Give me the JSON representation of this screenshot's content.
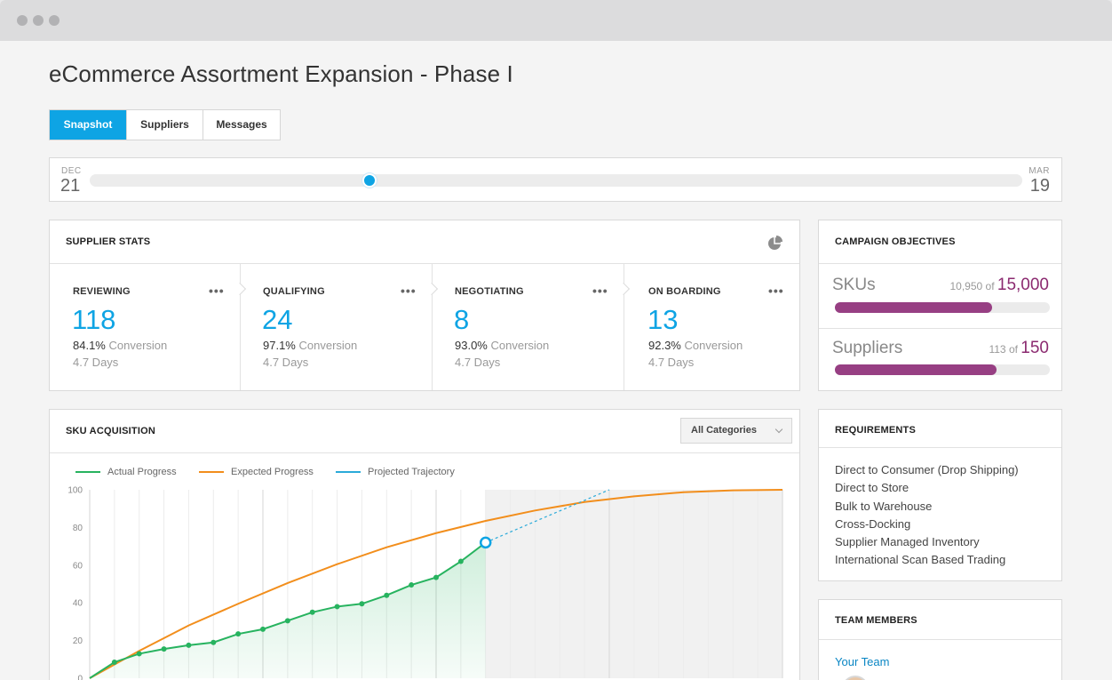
{
  "window": {
    "title_dots": [
      "close",
      "minimize",
      "maximize"
    ]
  },
  "page": {
    "title": "eCommerce Assortment Expansion - Phase I"
  },
  "tabs": [
    {
      "label": "Snapshot",
      "active": true
    },
    {
      "label": "Suppliers",
      "active": false
    },
    {
      "label": "Messages",
      "active": false
    }
  ],
  "timeline": {
    "start_month": "DEC",
    "start_day": "21",
    "end_month": "MAR",
    "end_day": "19",
    "position": 0.3
  },
  "supplier_stats": {
    "title": "SUPPLIER STATS",
    "icon": "pie-chart-icon",
    "stages": [
      {
        "label": "REVIEWING",
        "value": "118",
        "conversion": "84.1%",
        "conversion_label": "Conversion",
        "days": "4.7 Days"
      },
      {
        "label": "QUALIFYING",
        "value": "24",
        "conversion": "97.1%",
        "conversion_label": "Conversion",
        "days": "4.7 Days"
      },
      {
        "label": "NEGOTIATING",
        "value": "8",
        "conversion": "93.0%",
        "conversion_label": "Conversion",
        "days": "4.7 Days"
      },
      {
        "label": "ON BOARDING",
        "value": "13",
        "conversion": "92.3%",
        "conversion_label": "Conversion",
        "days": "4.7 Days"
      }
    ],
    "more_glyph": "•••"
  },
  "campaign_objectives": {
    "title": "CAMPAIGN OBJECTIVES",
    "items": [
      {
        "label": "SKUs",
        "current": "10,950",
        "of": "of",
        "total": "15,000",
        "progress": 0.73
      },
      {
        "label": "Suppliers",
        "current": "113",
        "of": "of",
        "total": "150",
        "progress": 0.753
      }
    ],
    "accent": "#973f83"
  },
  "sku_acquisition": {
    "title": "SKU ACQUISITION",
    "filter": "All Categories",
    "legend": [
      {
        "label": "Actual Progress",
        "color": "#27b35f"
      },
      {
        "label": "Expected Progress",
        "color": "#f28e1c"
      },
      {
        "label": "Projected Trajectory",
        "color": "#2aaad9"
      }
    ]
  },
  "chart_data": {
    "type": "line",
    "title": "",
    "xlabel": "",
    "ylabel": "",
    "ylim": [
      0,
      100
    ],
    "yticks": [
      0,
      20,
      40,
      60,
      80,
      100
    ],
    "x_count": 28,
    "grid": true,
    "series": [
      {
        "name": "Actual Progress",
        "x": [
          0,
          1,
          2,
          3,
          4,
          5,
          6,
          7,
          8,
          9,
          10,
          11,
          12,
          13,
          14,
          15,
          16
        ],
        "values": [
          0,
          8.5,
          13,
          15.5,
          17.5,
          19,
          23.5,
          26,
          30.5,
          35,
          38,
          39.5,
          44,
          49.5,
          53.5,
          62,
          72
        ]
      },
      {
        "name": "Expected Progress",
        "x": [
          0,
          2,
          4,
          6,
          8,
          10,
          12,
          14,
          16,
          18,
          20,
          22,
          24,
          26,
          28
        ],
        "values": [
          0,
          14.5,
          28,
          39.5,
          50.5,
          60.5,
          69.5,
          77,
          83.5,
          89,
          93.5,
          96.5,
          98.7,
          99.7,
          100
        ]
      },
      {
        "name": "Projected Trajectory",
        "x": [
          16,
          21
        ],
        "values": [
          72,
          100
        ]
      }
    ]
  },
  "requirements": {
    "title": "REQUIREMENTS",
    "items": [
      "Direct to Consumer (Drop Shipping)",
      "Direct to Store",
      "Bulk to Warehouse",
      "Cross-Docking",
      "Supplier Managed Inventory",
      "International Scan Based Trading"
    ]
  },
  "team_members": {
    "title": "TEAM MEMBERS",
    "link": "Your Team"
  }
}
